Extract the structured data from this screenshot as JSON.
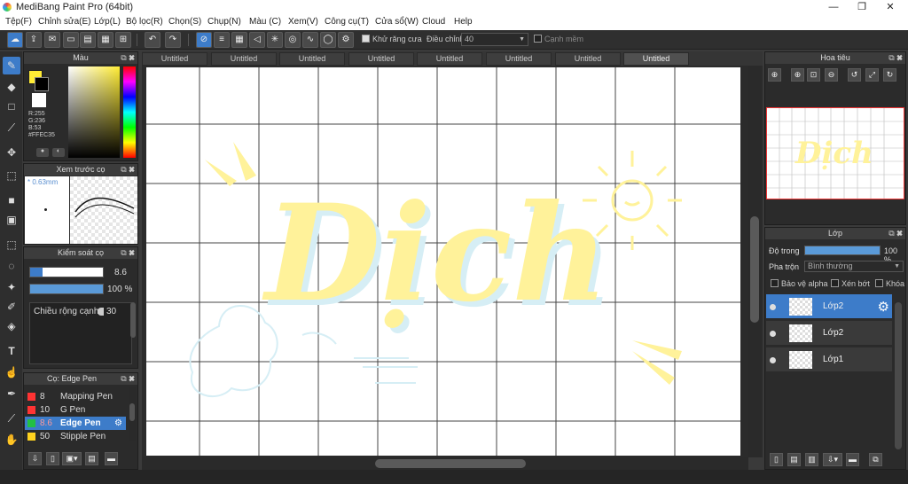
{
  "window": {
    "title": "MediBang Paint Pro (64bit)",
    "minimize": "—",
    "maximize": "❐",
    "close": "✕"
  },
  "menu": [
    "Tệp(F)",
    "Chỉnh sửa(E)",
    "Lớp(L)",
    "Bộ lọc(R)",
    "Chọn(S)",
    "Chụp(N)",
    "Màu (C)",
    "Xem(V)",
    "Công cụ(T)",
    "Cửa sổ(W)",
    "Cloud",
    "Help"
  ],
  "toolbar": {
    "antialias_label": "Khử răng cưa",
    "adjust_label": "Điều chỉnh",
    "adjust_value": "40",
    "sharp_edge_label": "Cạnh mềm"
  },
  "tabs": [
    "Untitled",
    "Untitled",
    "Untitled",
    "Untitled",
    "Untitled",
    "Untitled",
    "Untitled",
    "Untitled"
  ],
  "color_panel": {
    "title": "Màu",
    "r": "R:255",
    "g": "G:236",
    "b": "B:53",
    "hex": "#FFEC35",
    "primary": "#ffec35"
  },
  "brush_preview": {
    "title": "Xem trước cọ",
    "size": "0.63mm"
  },
  "brush_control": {
    "title": "Kiểm soát cọ",
    "size_value": "8.6",
    "opacity_value": "100 %",
    "size_fill": 1.0,
    "opacity_fill": 1.0,
    "pen_width_label": "Chiều rộng cạnh",
    "pen_width_value": "30"
  },
  "brush_list": {
    "title": "Cọ: Edge Pen",
    "items": [
      {
        "num": "8",
        "name": "Mapping Pen",
        "color": "#ff3333"
      },
      {
        "num": "10",
        "name": "G Pen",
        "color": "#ff3333"
      },
      {
        "num": "8.6",
        "name": "Edge Pen",
        "color": "#22c044"
      },
      {
        "num": "50",
        "name": "Stipple Pen",
        "color": "#ffd21f"
      }
    ]
  },
  "navigator": {
    "title": "Hoa tiêu"
  },
  "layers_panel": {
    "title": "Lớp",
    "opacity_label": "Độ trong",
    "opacity_value": "100 %",
    "opacity_fill": 1.0,
    "blend_label": "Pha trộn",
    "blend_value": "Bình thường",
    "protect_alpha": "Bảo vệ alpha",
    "clipping": "Xén bớt",
    "lock": "Khóa",
    "layers": [
      "Lớp2",
      "Lớp2",
      "Lớp1"
    ]
  },
  "canvas": {
    "lettering": "Dịch",
    "lettering_color": "#fff29a"
  }
}
